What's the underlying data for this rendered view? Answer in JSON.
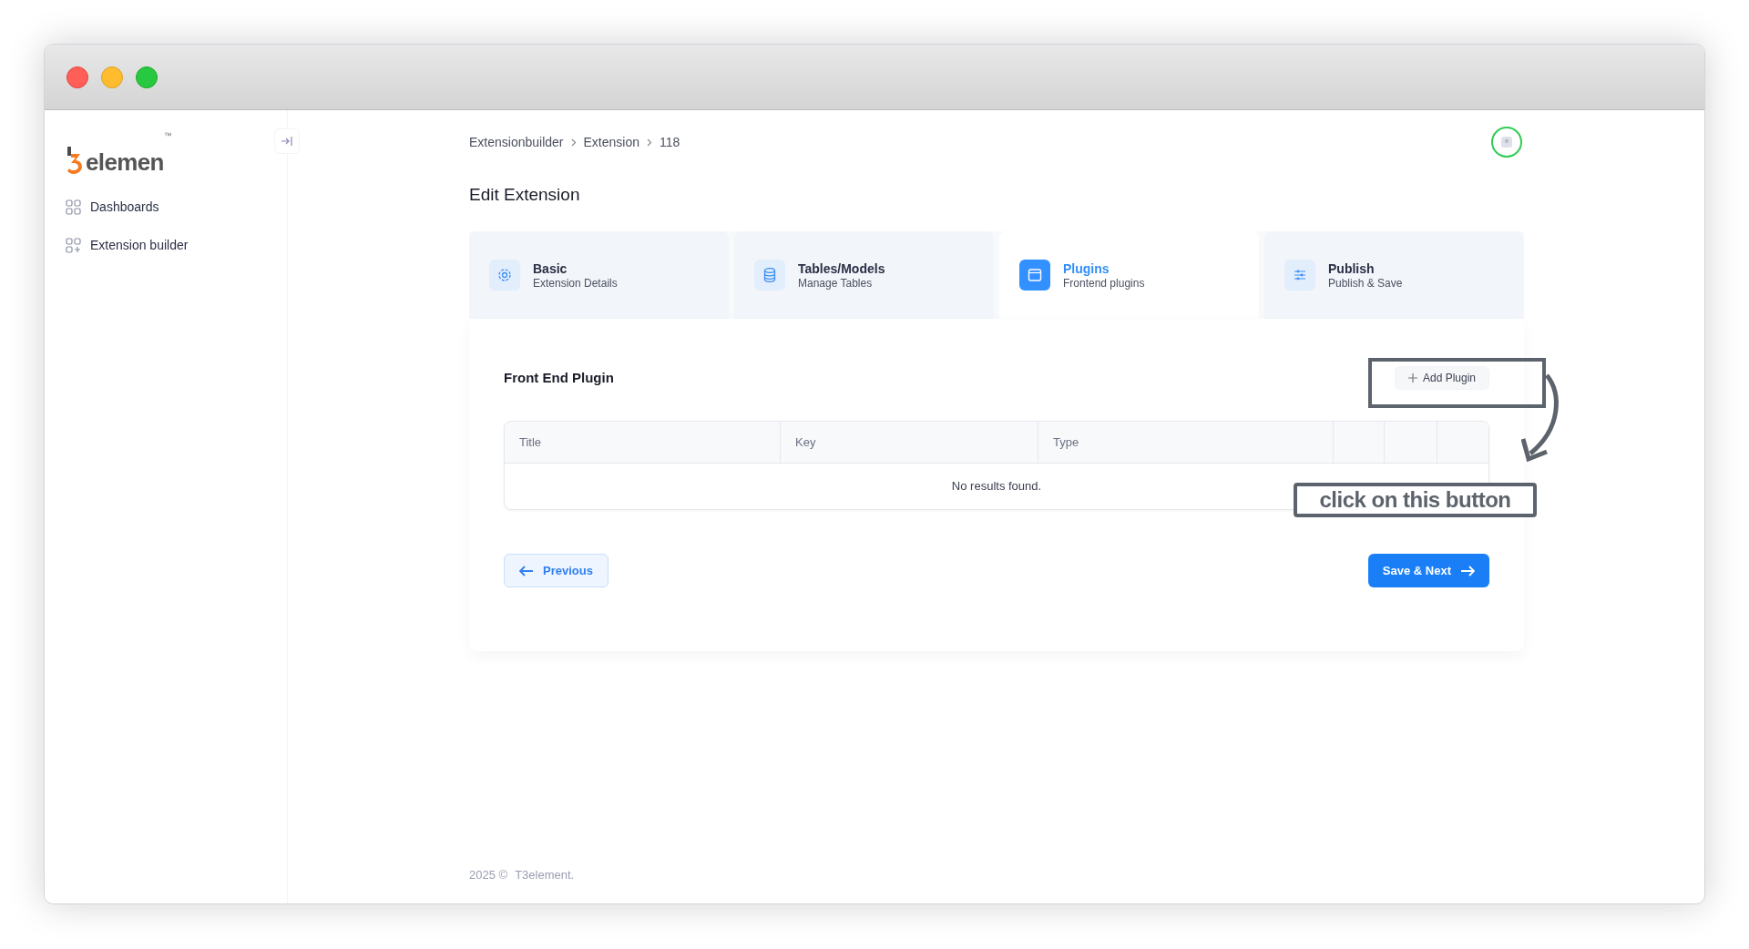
{
  "logo": {
    "text": "elemen",
    "trademark": "™"
  },
  "sidebar": {
    "items": [
      {
        "label": "Dashboards"
      },
      {
        "label": "Extension builder"
      }
    ]
  },
  "breadcrumb": [
    "Extensionbuilder",
    "Extension",
    "118"
  ],
  "page_title": "Edit Extension",
  "tabs": [
    {
      "label": "Basic",
      "subtitle": "Extension Details",
      "selected": false
    },
    {
      "label": "Tables/Models",
      "subtitle": "Manage Tables",
      "selected": false
    },
    {
      "label": "Plugins",
      "subtitle": "Frontend plugins",
      "selected": true
    },
    {
      "label": "Publish",
      "subtitle": "Publish & Save",
      "selected": false
    }
  ],
  "section_title": "Front End Plugin",
  "add_button": "Add Plugin",
  "table": {
    "columns": [
      "Title",
      "Key",
      "Type"
    ],
    "empty_message": "No results found."
  },
  "buttons": {
    "previous": "Previous",
    "next": "Save & Next"
  },
  "annotation": "click on this button",
  "footer": {
    "year": "2025 ©",
    "brand": "T3element."
  }
}
